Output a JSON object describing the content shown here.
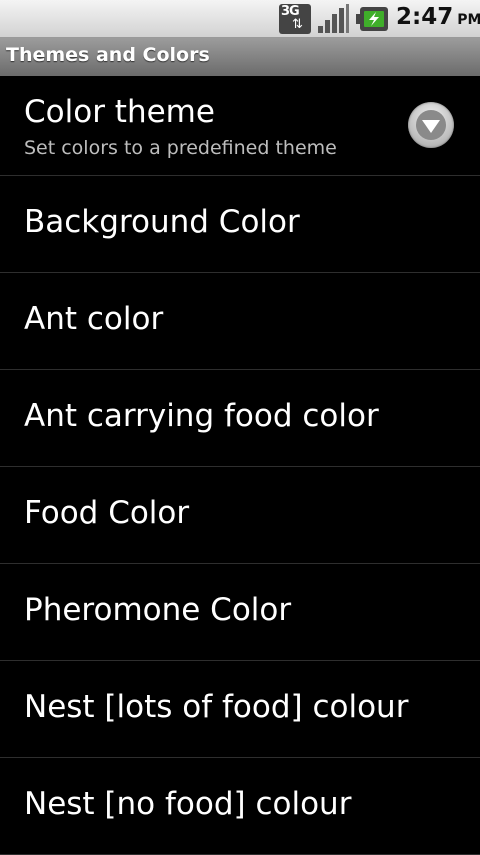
{
  "status_bar": {
    "network_type": "3G",
    "network_arrows": "⇅",
    "time": "2:47",
    "ampm": "PM",
    "icons": [
      "3g-data-icon",
      "signal-strength-icon",
      "battery-charging-icon"
    ]
  },
  "title_bar": {
    "title": "Themes and Colors"
  },
  "preferences": [
    {
      "label": "Color theme",
      "summary": "Set colors to a predefined theme",
      "widget": "chevron-down-icon"
    },
    {
      "label": "Background Color"
    },
    {
      "label": "Ant color"
    },
    {
      "label": "Ant carrying food color"
    },
    {
      "label": "Food Color"
    },
    {
      "label": "Pheromone Color"
    },
    {
      "label": "Nest [lots of food] colour"
    },
    {
      "label": "Nest [no food] colour"
    }
  ],
  "colors": {
    "background": "#000000",
    "divider": "#2e2e2e",
    "battery_accent": "#3fae2a"
  }
}
